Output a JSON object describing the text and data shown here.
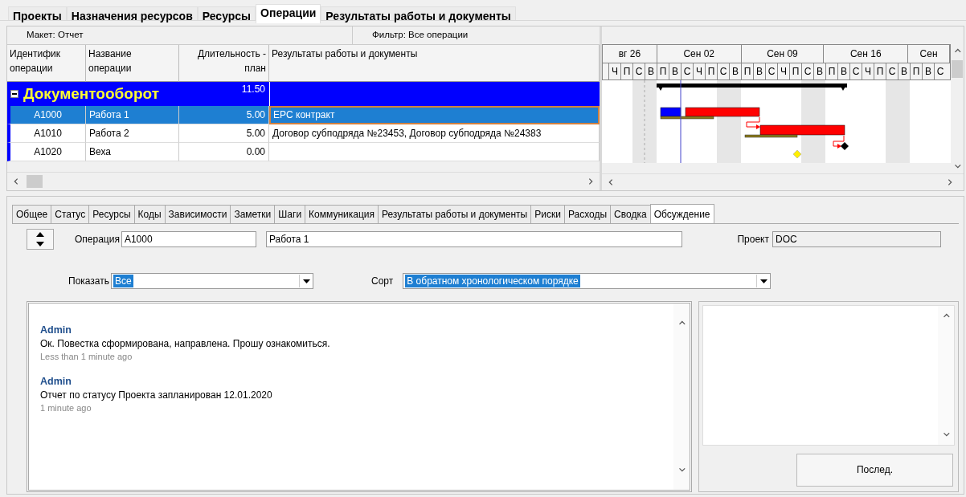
{
  "main_tabs": [
    {
      "label": "Проекты",
      "selected": false
    },
    {
      "label": "Назначения ресурсов",
      "selected": false
    },
    {
      "label": "Ресурсы",
      "selected": false
    },
    {
      "label": "Операции",
      "selected": true
    },
    {
      "label": "Результаты работы и документы",
      "selected": false
    }
  ],
  "layout_bar": {
    "layout": "Макет: Отчет",
    "filter": "Фильтр: Все операции"
  },
  "table": {
    "columns": [
      "Идентифик\nоперации",
      "Название\nоперации",
      "Длительность -\nплан",
      "Результаты работы и документы"
    ],
    "group": {
      "name": "Документооборот",
      "duration": "11.50",
      "expanded": true
    },
    "rows": [
      {
        "id": "A1000",
        "name": "Работа 1",
        "duration": "5.00",
        "results": "EPC контракт",
        "selected": true
      },
      {
        "id": "A1010",
        "name": "Работа 2",
        "duration": "5.00",
        "results": "Договор субподряда №23453, Договор  субподряда №24383",
        "selected": false
      },
      {
        "id": "A1020",
        "name": "Веха",
        "duration": "0.00",
        "results": "",
        "selected": false
      }
    ]
  },
  "gantt": {
    "months": [
      "вг 26",
      "Сен 02",
      "Сен 09",
      "Сен 16",
      "Сен"
    ],
    "days": [
      "Ч",
      "П",
      "С",
      "В",
      "П",
      "В",
      "С",
      "Ч",
      "П",
      "С",
      "В",
      "П",
      "В",
      "С",
      "Ч",
      "П",
      "С",
      "В",
      "П",
      "В",
      "С",
      "Ч",
      "П",
      "С",
      "В",
      "П",
      "В",
      "С"
    ]
  },
  "detail_tabs": [
    {
      "label": "Общее",
      "selected": false
    },
    {
      "label": "Статус",
      "selected": false
    },
    {
      "label": "Ресурсы",
      "selected": false
    },
    {
      "label": "Коды",
      "selected": false
    },
    {
      "label": "Зависимости",
      "selected": false
    },
    {
      "label": "Заметки",
      "selected": false
    },
    {
      "label": "Шаги",
      "selected": false
    },
    {
      "label": "Коммуникация",
      "selected": false
    },
    {
      "label": "Результаты работы и документы",
      "selected": false
    },
    {
      "label": "Риски",
      "selected": false
    },
    {
      "label": "Расходы",
      "selected": false
    },
    {
      "label": "Сводка",
      "selected": false
    },
    {
      "label": "Обсуждение",
      "selected": true
    }
  ],
  "operation": {
    "label": "Операция",
    "id": "A1000",
    "name": "Работа 1"
  },
  "project": {
    "label": "Проект",
    "value": "DOC"
  },
  "show": {
    "label": "Показать",
    "value": "Все"
  },
  "sort": {
    "label": "Сорт",
    "value": "В обратном хронологическом порядке"
  },
  "comments": [
    {
      "author": "Admin",
      "text": "Ок. Повестка сформирована, направлена. Прошу ознакомиться.",
      "time": "Less than 1 minute ago"
    },
    {
      "author": "Admin",
      "text": "Отчет по статусу Проекта запланирован 12.01.2020",
      "time": "1 minute ago"
    }
  ],
  "last_button": "Послед."
}
